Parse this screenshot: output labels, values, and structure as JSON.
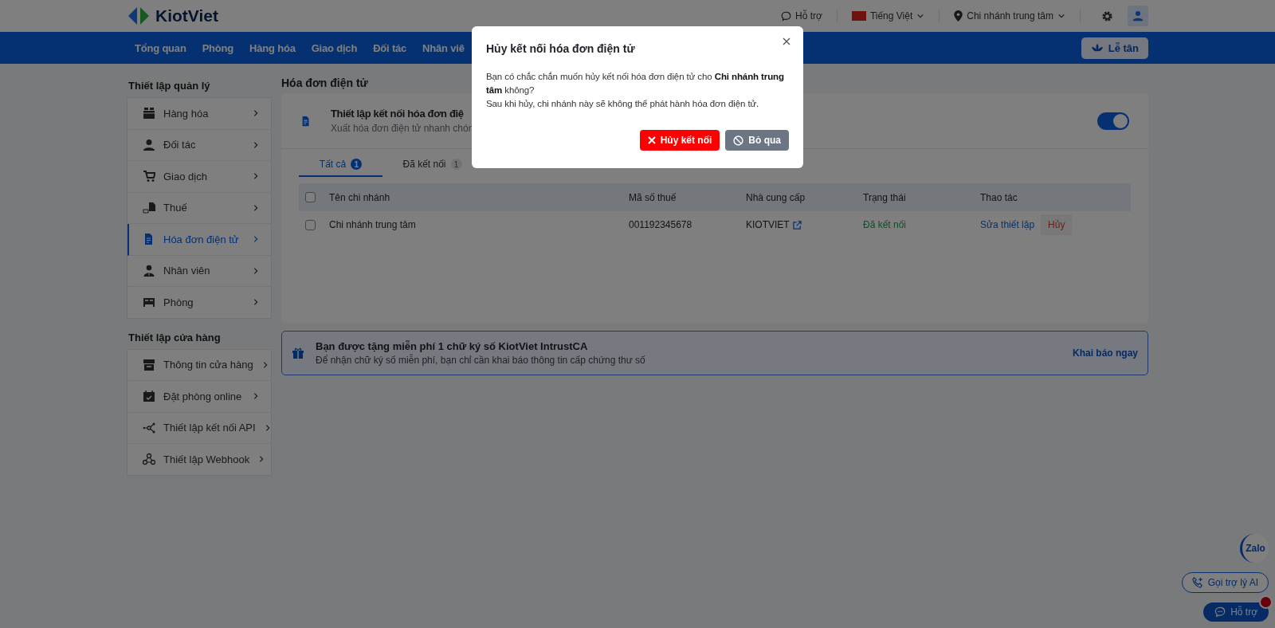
{
  "header": {
    "logo_text": "KiotViet",
    "support": "Hỗ trợ",
    "language": "Tiếng Việt",
    "branch": "Chi nhánh trung tâm"
  },
  "nav": {
    "items": [
      {
        "label": "Tổng quan"
      },
      {
        "label": "Phòng"
      },
      {
        "label": "Hàng hóa"
      },
      {
        "label": "Giao dịch"
      },
      {
        "label": "Đối tác"
      },
      {
        "label": "Nhân viê"
      }
    ],
    "reception_button": "Lễ tân"
  },
  "sidebar": {
    "sections": [
      {
        "title": "Thiết lập quản lý",
        "items": [
          {
            "label": "Hàng hóa",
            "selected": false
          },
          {
            "label": "Đối tác",
            "selected": false
          },
          {
            "label": "Giao dịch",
            "selected": false
          },
          {
            "label": "Thuế",
            "selected": false
          },
          {
            "label": "Hóa đơn điện tử",
            "selected": true
          },
          {
            "label": "Nhân viên",
            "selected": false
          },
          {
            "label": "Phòng",
            "selected": false
          }
        ]
      },
      {
        "title": "Thiết lập cửa hàng",
        "items": [
          {
            "label": "Thông tin cửa hàng",
            "selected": false
          },
          {
            "label": "Đặt phòng online",
            "selected": false
          },
          {
            "label": "Thiết lập kết nối API",
            "selected": false
          },
          {
            "label": "Thiết lập Webhook",
            "selected": false
          }
        ]
      }
    ]
  },
  "main": {
    "title": "Hóa đơn điện tử",
    "setup": {
      "title": "Thiết lập kết nối hóa đơn điệ",
      "subtitle": "Xuất hóa đơn điện tử nhanh chón",
      "enabled": true
    },
    "tabs": [
      {
        "label": "Tất cả",
        "count": "1",
        "selected": true
      },
      {
        "label": "Đã kết nối",
        "count": "1",
        "selected": false
      }
    ],
    "table": {
      "header_checked": false,
      "columns": [
        "Tên chi nhánh",
        "Mã số thuế",
        "Nhà cung cấp",
        "Trạng thái",
        "Thao tác"
      ],
      "rows": [
        {
          "checked": false,
          "branch": "Chi nhánh trung tâm",
          "tax_code": "001192345678",
          "provider": "KIOTVIET",
          "status": "Đã kết nối",
          "edit_link": "Sửa thiết lập",
          "cancel_button": "Hủy"
        }
      ]
    }
  },
  "banner": {
    "title": "Bạn được tặng miễn phí 1 chữ ký số KiotViet IntrustCA",
    "text": "Để nhận chữ ký số miễn phí, bạn chỉ cần khai báo thông tin cấp chứng thư số",
    "link": "Khai báo ngay"
  },
  "dialog": {
    "title": "Hủy kết nối hóa đơn điện tử",
    "message": "Bạn có chắc chắn muốn hủy kết nối hóa đơn điện tử cho **Chi nhánh trung tâm** không?",
    "note": "Sau khi hủy, chi nhánh này sẽ không thể phát hành hóa đơn điện tử.",
    "buttons": [
      {
        "label": "Hủy kết nối",
        "kind": "danger"
      },
      {
        "label": "Bỏ qua",
        "kind": "secondary"
      }
    ]
  },
  "widgets": {
    "zalo": "Zalo",
    "ai_call": "Gọi trợ lý AI",
    "support": "Hỗ trợ",
    "support_notification": true
  }
}
